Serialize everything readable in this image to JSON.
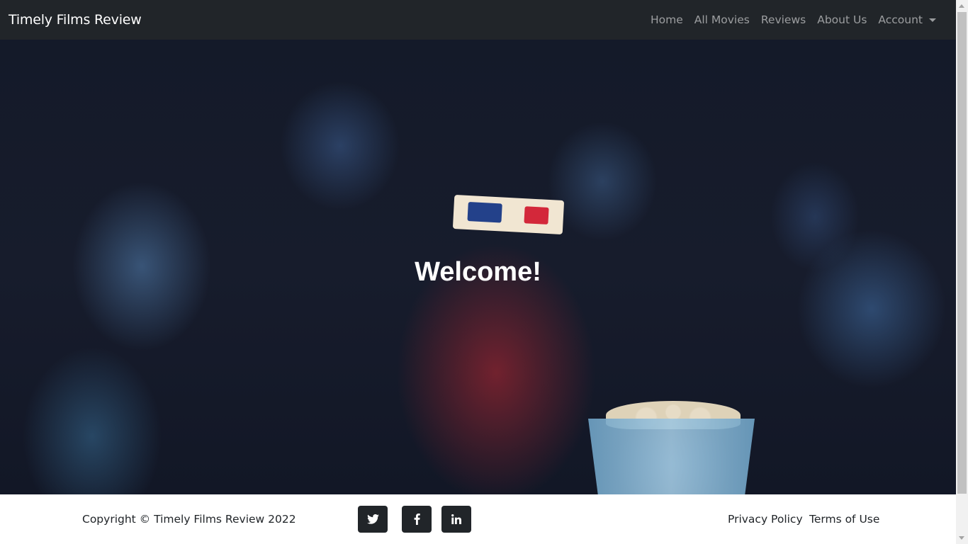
{
  "navbar": {
    "brand": "Timely Films Review",
    "links": [
      {
        "label": "Home"
      },
      {
        "label": "All Movies"
      },
      {
        "label": "Reviews"
      },
      {
        "label": "About Us"
      },
      {
        "label": "Account"
      }
    ],
    "background": "#212529"
  },
  "hero": {
    "heading": "Welcome!"
  },
  "footer": {
    "copyright": "Copyright © Timely Films Review 2022",
    "social": [
      {
        "icon": "twitter-icon"
      },
      {
        "icon": "facebook-icon"
      },
      {
        "icon": "linkedin-icon"
      }
    ],
    "links": [
      {
        "label": "Privacy Policy"
      },
      {
        "label": "Terms of Use"
      }
    ]
  }
}
